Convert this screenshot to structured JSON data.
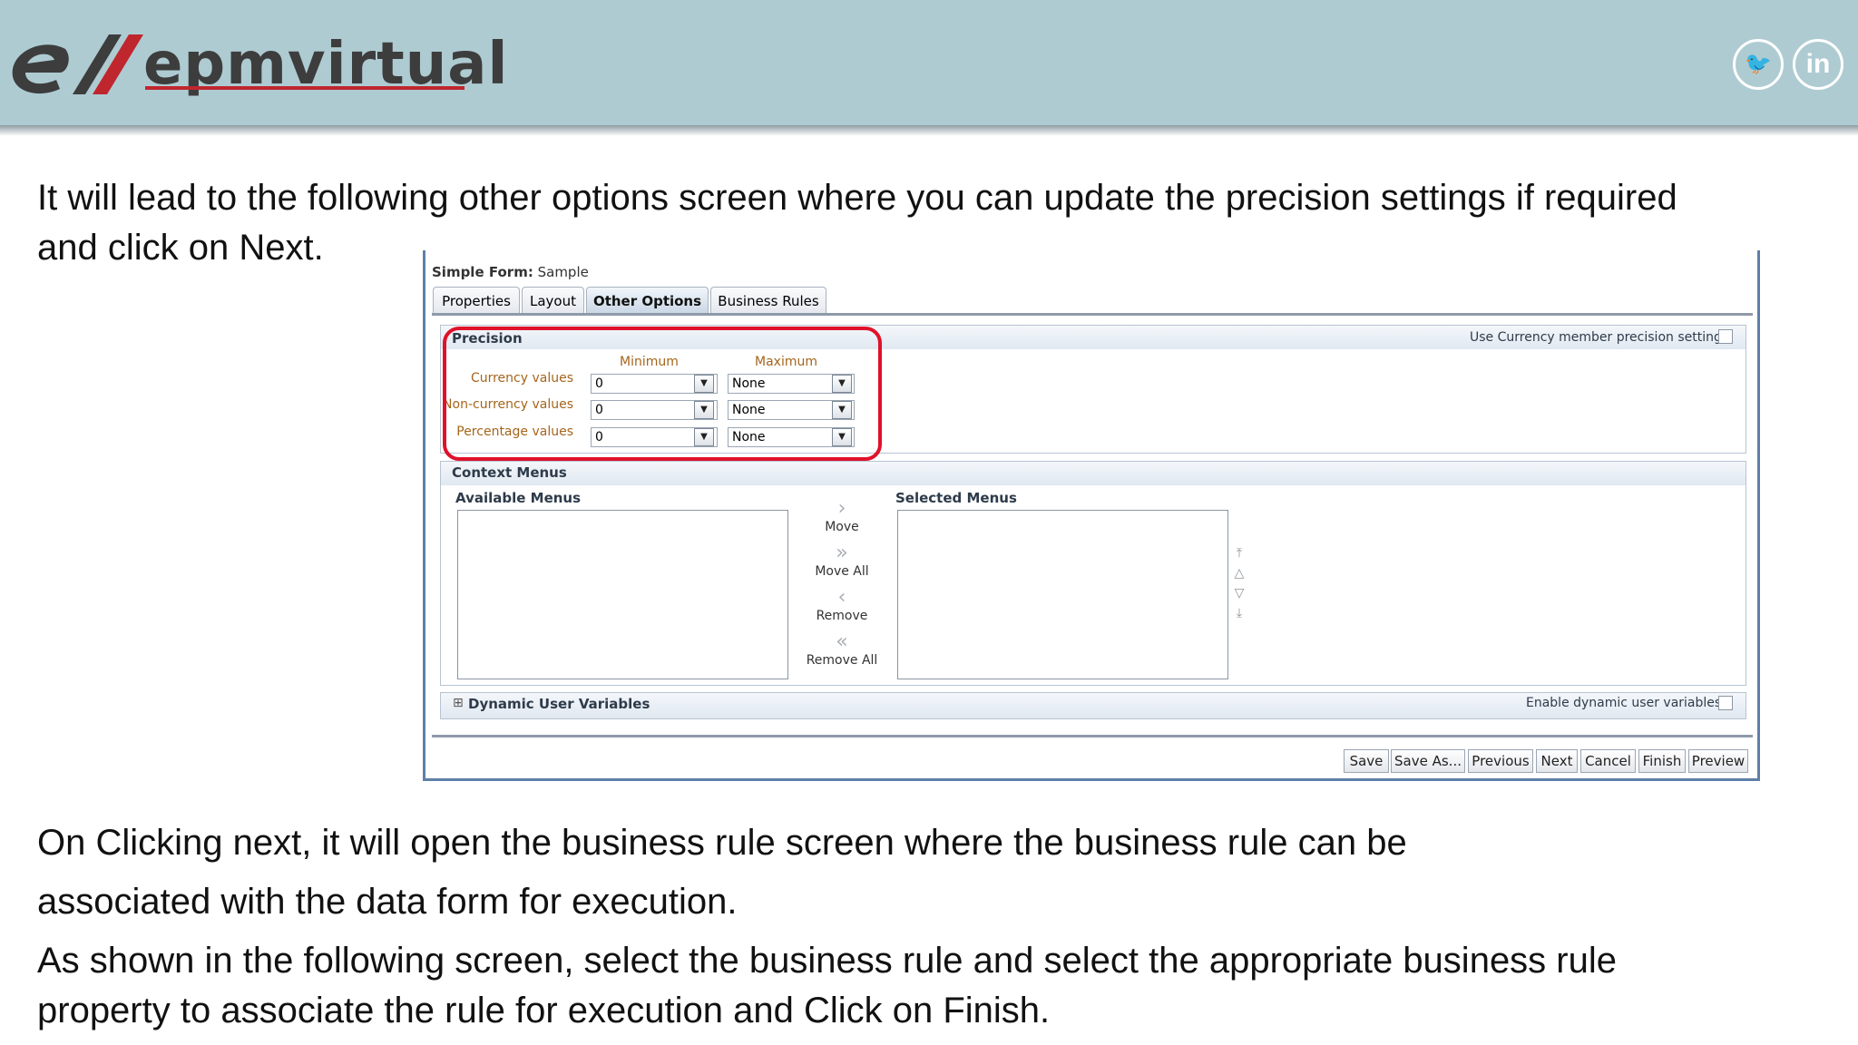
{
  "header": {
    "logo_text": "epmvirtual",
    "social": [
      "twitter-icon",
      "linkedin-icon"
    ],
    "twitter_glyph": "🐦",
    "linkedin_glyph": "in"
  },
  "slide": {
    "line1": "It will lead to the following other options screen where you can update the precision settings if required",
    "line2": "and click on Next.",
    "line3": "On Clicking next, it will open the business rule screen where the business rule can be",
    "line4": "associated with the data form for execution.",
    "line5": "As shown in the following screen, select the business rule and select the appropriate business rule",
    "line6": "property to associate the rule for execution and Click on Finish."
  },
  "form": {
    "title_bold": "Simple Form:",
    "title_name": "Sample",
    "tabs": [
      "Properties",
      "Layout",
      "Other Options",
      "Business Rules"
    ],
    "active_tab": "Other Options",
    "precision": {
      "heading": "Precision",
      "currency_setting_label": "Use Currency member precision setting",
      "col_min": "Minimum",
      "col_max": "Maximum",
      "rows": [
        {
          "label": "Currency values",
          "min": "0",
          "max": "None"
        },
        {
          "label": "Non-currency values",
          "min": "0",
          "max": "None"
        },
        {
          "label": "Percentage values",
          "min": "0",
          "max": "None"
        }
      ]
    },
    "context_menus": {
      "heading": "Context Menus",
      "available": "Available Menus",
      "selected": "Selected Menus",
      "move": "Move",
      "move_all": "Move All",
      "remove": "Remove",
      "remove_all": "Remove All"
    },
    "dynamic": {
      "heading": "Dynamic User Variables",
      "enable_label": "Enable dynamic user variables",
      "expand_glyph": "⊞"
    },
    "buttons": [
      "Save",
      "Save As...",
      "Previous",
      "Next",
      "Cancel",
      "Finish",
      "Preview"
    ]
  },
  "colors": {
    "header_bg": "#aecbd2",
    "highlight": "#e0112b",
    "frame_border": "#5f7fa8"
  }
}
